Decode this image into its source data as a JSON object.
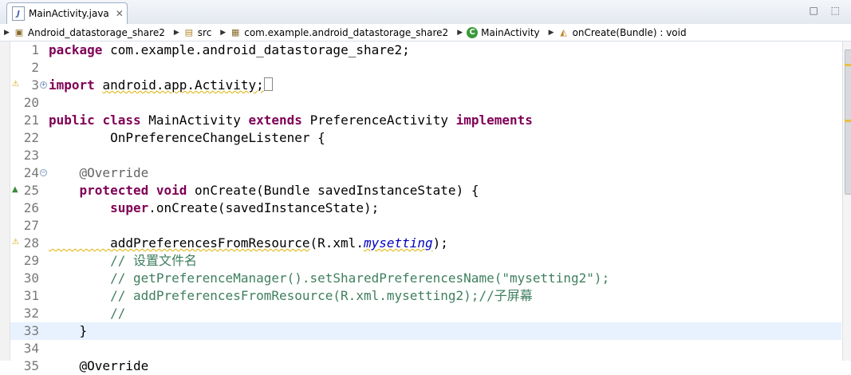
{
  "tab": {
    "filename": "MainActivity.java",
    "close_glyph": "✕"
  },
  "window_controls": "□ ⬚",
  "breadcrumb": [
    {
      "icon": "project-icon",
      "label": "Android_datastorage_share2"
    },
    {
      "icon": "source-folder-icon",
      "label": "src"
    },
    {
      "icon": "package-icon",
      "label": "com.example.android_datastorage_share2"
    },
    {
      "icon": "class-icon",
      "label": "MainActivity"
    },
    {
      "icon": "method-icon",
      "label": "onCreate(Bundle) : void"
    }
  ],
  "code_lines": [
    {
      "num": "1",
      "parts": [
        [
          "kw",
          "package"
        ],
        [
          "",
          "com.example.android_datastorage_share2;"
        ]
      ]
    },
    {
      "num": "2",
      "parts": []
    },
    {
      "num": "3",
      "marker": "warning",
      "fold": "+",
      "parts": [
        [
          "kw",
          "import"
        ],
        [
          "",
          ""
        ],
        [
          "warn",
          "android.app.Activity;"
        ],
        [
          "box",
          ""
        ]
      ]
    },
    {
      "num": "20",
      "parts": []
    },
    {
      "num": "21",
      "parts": [
        [
          "kw",
          "public"
        ],
        [
          "",
          ""
        ],
        [
          "kw",
          "class"
        ],
        [
          "",
          "MainActivity"
        ],
        [
          "kw",
          "extends"
        ],
        [
          "",
          "PreferenceActivity"
        ],
        [
          "kw",
          "implements"
        ]
      ]
    },
    {
      "num": "22",
      "parts": [
        [
          "",
          "        OnPreferenceChangeListener {"
        ]
      ]
    },
    {
      "num": "23",
      "parts": []
    },
    {
      "num": "24",
      "fold": "−",
      "parts": [
        [
          "ann",
          "    @Override"
        ]
      ]
    },
    {
      "num": "25",
      "marker": "override",
      "parts": [
        [
          "kw",
          "    protected"
        ],
        [
          "kw",
          "void"
        ],
        [
          "",
          "onCreate(Bundle savedInstanceState) {"
        ]
      ]
    },
    {
      "num": "26",
      "parts": [
        [
          "kw",
          "        super"
        ],
        [
          "",
          ".onCreate(savedInstanceState);"
        ]
      ]
    },
    {
      "num": "27",
      "parts": []
    },
    {
      "num": "28",
      "marker": "warning",
      "parts": [
        [
          "dep",
          "        addPreferencesFromResource"
        ],
        [
          "",
          "(R.xml."
        ],
        [
          "field",
          "mysetting"
        ],
        [
          "",
          ");"
        ]
      ]
    },
    {
      "num": "29",
      "parts": [
        [
          "cmt",
          "        // 设置文件名"
        ]
      ]
    },
    {
      "num": "30",
      "parts": [
        [
          "cmt",
          "        // getPreferenceManager().setSharedPreferencesName(\"mysetting2\");"
        ]
      ]
    },
    {
      "num": "31",
      "parts": [
        [
          "cmt",
          "        // addPreferencesFromResource(R.xml.mysetting2);//子屏幕"
        ]
      ]
    },
    {
      "num": "32",
      "parts": [
        [
          "cmt",
          "        //"
        ]
      ]
    },
    {
      "num": "33",
      "current": true,
      "parts": [
        [
          "",
          "    }"
        ]
      ]
    },
    {
      "num": "34",
      "parts": []
    },
    {
      "num": "35",
      "parts": [
        [
          "",
          "    @Override"
        ]
      ]
    }
  ],
  "colors": {
    "keyword": "#7f0055",
    "comment": "#3f7f5f",
    "annotation": "#646464",
    "field": "#0000c0",
    "current_line": "#e8f2fe"
  }
}
